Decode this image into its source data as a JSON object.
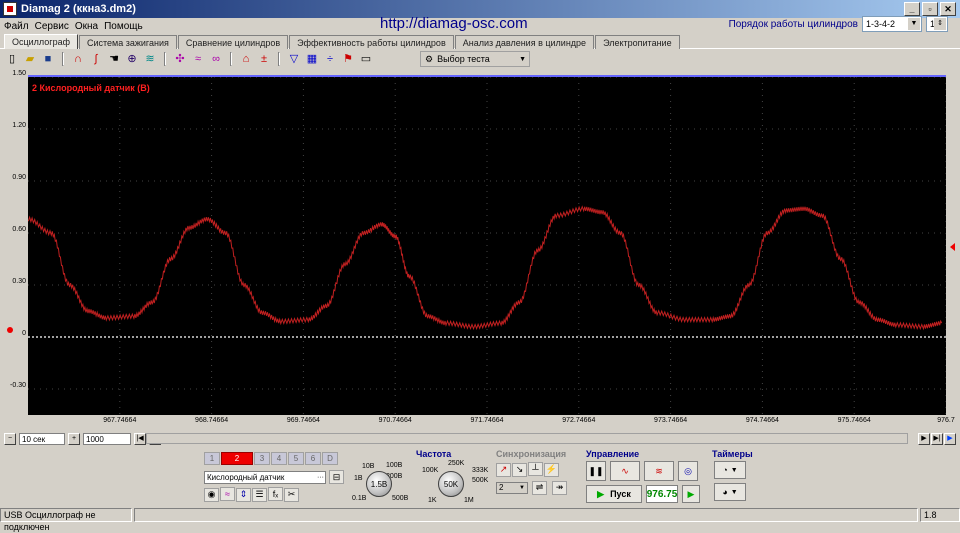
{
  "window": {
    "title": "Diamag 2 (ккна3.dm2)",
    "controls": [
      "_",
      "▫",
      "✕"
    ]
  },
  "menu": [
    "Файл",
    "Сервис",
    "Окна",
    "Помощь"
  ],
  "url": "http://diamag-osc.com",
  "cylinder_order": {
    "label": "Порядок работы цилиндров",
    "value": "1-3-4-2",
    "spin_value": "1"
  },
  "tabs": [
    "Осциллограф",
    "Система зажигания",
    "Сравнение цилиндров",
    "Эффективность работы цилиндров",
    "Анализ давления в цилиндре",
    "Электропитание"
  ],
  "active_tab": 0,
  "toolbar": {
    "test_select": "Выбор теста"
  },
  "chart_data": {
    "type": "line",
    "title": "2 Кислородный датчик (В)",
    "ylim": [
      -0.45,
      1.5
    ],
    "yticks": [
      "1.50",
      "1.20",
      "0.90",
      "0.60",
      "0.30",
      "0",
      "-0.30"
    ],
    "ytick_values": [
      1.5,
      1.2,
      0.9,
      0.6,
      0.3,
      0,
      -0.3
    ],
    "xticks": [
      "967.74664",
      "968.74664",
      "969.74664",
      "970.74664",
      "971.74664",
      "972.74664",
      "973.74664",
      "974.74664",
      "975.74664",
      "976.7"
    ],
    "xtick_values": [
      967.74664,
      968.74664,
      969.74664,
      970.74664,
      971.74664,
      972.74664,
      973.74664,
      974.74664,
      975.74664,
      976.74664
    ],
    "xlim": [
      966.74664,
      976.74664
    ],
    "series": [
      {
        "color": "#c02020",
        "x": [
          966.75,
          967.0,
          967.2,
          967.4,
          967.6,
          967.9,
          968.1,
          968.3,
          968.5,
          968.7,
          968.9,
          969.1,
          969.3,
          969.5,
          969.8,
          970.0,
          970.2,
          970.4,
          970.6,
          970.75,
          970.9,
          971.1,
          971.3,
          971.6,
          971.9,
          972.1,
          972.3,
          972.5,
          972.8,
          973.0,
          973.2,
          973.4,
          973.6,
          973.9,
          974.2,
          974.4,
          974.6,
          974.8,
          975.0,
          975.2,
          975.4,
          975.6,
          975.8,
          976.0,
          976.2,
          976.5,
          976.7
        ],
        "y": [
          0.68,
          0.6,
          0.3,
          0.15,
          0.11,
          0.12,
          0.2,
          0.45,
          0.63,
          0.68,
          0.6,
          0.3,
          0.14,
          0.09,
          0.1,
          0.18,
          0.42,
          0.6,
          0.65,
          0.58,
          0.35,
          0.12,
          0.08,
          0.06,
          0.08,
          0.2,
          0.5,
          0.7,
          0.74,
          0.72,
          0.6,
          0.3,
          0.14,
          0.1,
          0.1,
          0.12,
          0.3,
          0.6,
          0.73,
          0.74,
          0.7,
          0.45,
          0.2,
          0.1,
          0.07,
          0.06,
          0.08
        ]
      }
    ],
    "grid": true,
    "zero_line": true
  },
  "nav": {
    "time_window": "10 сек",
    "count": "1000"
  },
  "channels": {
    "buttons": [
      "1",
      "2",
      "3",
      "4",
      "5",
      "6",
      "D"
    ],
    "active": "2",
    "sensor": "Кислородный датчик",
    "voltage_scale": "1.5В",
    "scale_labels": [
      "10В",
      "100В",
      "200В",
      "1В",
      "0.1В",
      "500В"
    ]
  },
  "frequency": {
    "title": "Частота",
    "value": "50K",
    "labels": [
      "250K",
      "100K",
      "333K",
      "500K",
      "1K",
      "1M"
    ]
  },
  "sync": {
    "title": "Синхронизация",
    "channel": "2"
  },
  "control": {
    "title": "Управление",
    "start_label": "Пуск",
    "time": "976.75"
  },
  "timers": {
    "title": "Таймеры"
  },
  "status": {
    "left": "USB Осциллограф не подключен",
    "right": "1.8"
  }
}
